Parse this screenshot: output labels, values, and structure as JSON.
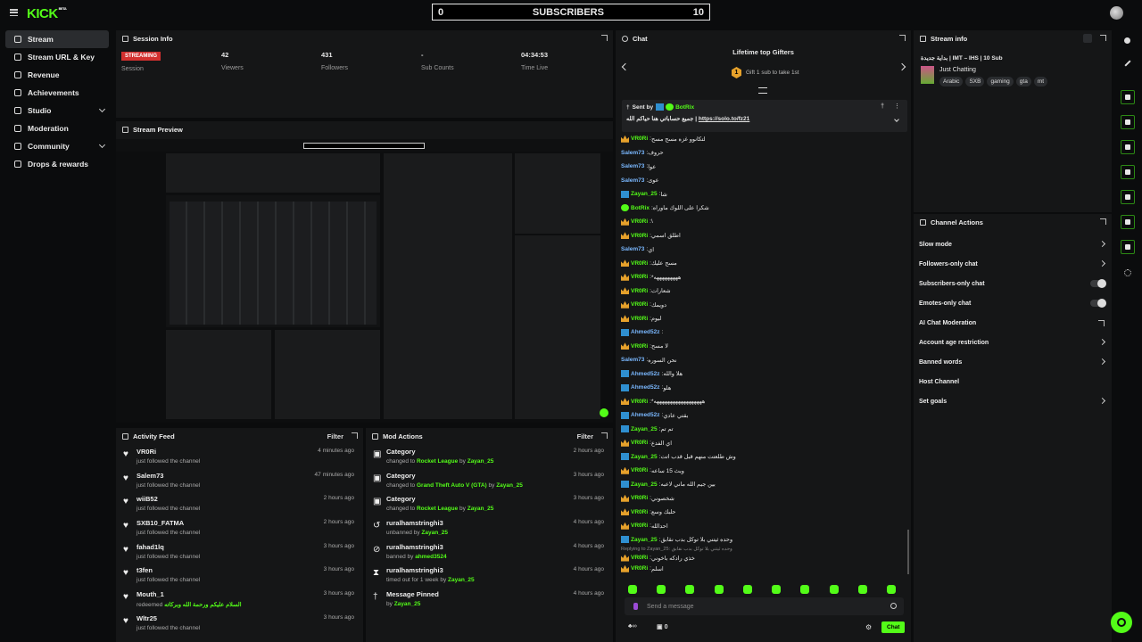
{
  "topbar": {
    "logo": "KICK",
    "logo_badge": "BETA",
    "sub_left": "0",
    "sub_title": "SUBSCRIBERS",
    "sub_right": "10"
  },
  "sidebar": {
    "items": [
      {
        "label": "Stream",
        "active": true,
        "chev": false
      },
      {
        "label": "Stream URL & Key",
        "chev": false
      },
      {
        "label": "Revenue",
        "chev": false
      },
      {
        "label": "Achievements",
        "chev": false
      },
      {
        "label": "Studio",
        "chev": true
      },
      {
        "label": "Moderation",
        "chev": false
      },
      {
        "label": "Community",
        "chev": true
      },
      {
        "label": "Drops & rewards",
        "chev": false
      }
    ]
  },
  "session": {
    "title": "Session Info",
    "status": "STREAMING",
    "session_label": "Session",
    "viewers": "42",
    "viewers_label": "Viewers",
    "followers": "431",
    "followers_label": "Followers",
    "subs": "-",
    "subs_label": "Sub Counts",
    "time": "04:34:53",
    "time_label": "Time Live"
  },
  "preview": {
    "title": "Stream Preview"
  },
  "activity": {
    "title": "Activity Feed",
    "filter": "Filter",
    "rows": [
      {
        "name": "VR0Ri",
        "sub": "just followed the channel",
        "time": "4 minutes ago"
      },
      {
        "name": "Salem73",
        "sub": "just followed the channel",
        "time": "47 minutes ago"
      },
      {
        "name": "wiiB52",
        "sub": "just followed the channel",
        "time": "2 hours ago"
      },
      {
        "name": "SXB10_FATMA",
        "sub": "just followed the channel",
        "time": "2 hours ago"
      },
      {
        "name": "fahad1lq",
        "sub": "just followed the channel",
        "time": "3 hours ago"
      },
      {
        "name": "t3fen",
        "sub": "just followed the channel",
        "time": "3 hours ago"
      },
      {
        "name": "Mouth_1",
        "sub": "redeemed",
        "extra": "السلام عليكم ورحمة الله وبركاته",
        "time": "3 hours ago"
      },
      {
        "name": "Wltr25",
        "sub": "just followed the channel",
        "time": "3 hours ago"
      }
    ]
  },
  "mod": {
    "title": "Mod Actions",
    "filter": "Filter",
    "rows": [
      {
        "name": "Category",
        "pre": "changed to",
        "target": "Rocket League",
        "by": "Zayan_25",
        "time": "2 hours ago"
      },
      {
        "name": "Category",
        "pre": "changed to",
        "target": "Grand Theft Auto V (GTA)",
        "by": "Zayan_25",
        "time": "3 hours ago"
      },
      {
        "name": "Category",
        "pre": "changed to",
        "target": "Rocket League",
        "by": "Zayan_25",
        "time": "3 hours ago"
      },
      {
        "name": "ruralhamstringhi3",
        "pre": "unbanned by",
        "target": "Zayan_25",
        "by": "",
        "time": "4 hours ago"
      },
      {
        "name": "ruralhamstringhi3",
        "pre": "banned by",
        "target": "ahmed3524",
        "by": "",
        "time": "4 hours ago"
      },
      {
        "name": "ruralhamstringhi3",
        "pre": "timed out for 1 week by",
        "target": "Zayan_25",
        "by": "",
        "time": "4 hours ago"
      },
      {
        "name": "Message Pinned",
        "pre": "by",
        "target": "Zayan_25",
        "by": "",
        "time": "4 hours ago"
      }
    ]
  },
  "chat": {
    "title": "Chat",
    "gifters_title": "Lifetime top Gifters",
    "gift_rank": "1",
    "gift_text": "Gift 1 sub to take 1st",
    "pinned_by_label": "Sent by",
    "pinned_user": "BotRix",
    "pinned_text": "جميع حساباتي هنا حياكم الله |",
    "pinned_link": "https://solo.to/fz21",
    "messages": [
      {
        "u": "VR0Ri",
        "c": "#53fc18",
        "b": "crown",
        "t": "لتكانوو غزه مسح مسح"
      },
      {
        "u": "Salem73",
        "c": "#7ab8ff",
        "b": "",
        "t": "حروف"
      },
      {
        "u": "Salem73",
        "c": "#7ab8ff",
        "b": "",
        "t": "عوا"
      },
      {
        "u": "Salem73",
        "c": "#7ab8ff",
        "b": "",
        "t": "عوى"
      },
      {
        "u": "Zayan_25",
        "c": "#53fc18",
        "b": "bolt",
        "t": "شا"
      },
      {
        "u": "BotRix",
        "c": "#53fc18",
        "b": "green",
        "t": "شكرا على اللوك ماوراه"
      },
      {
        "u": "VR0Ri",
        "c": "#53fc18",
        "b": "crown",
        "t": "\\"
      },
      {
        "u": "VR0Ri",
        "c": "#53fc18",
        "b": "crown",
        "t": "اطلق اسمي"
      },
      {
        "u": "Salem73",
        "c": "#7ab8ff",
        "b": "",
        "t": "اي"
      },
      {
        "u": "VR0Ri",
        "c": "#53fc18",
        "b": "crown",
        "t": "مسح عليك"
      },
      {
        "u": "VR0Ri",
        "c": "#53fc18",
        "b": "crown",
        "t": "*هههههههههه"
      },
      {
        "u": "VR0Ri",
        "c": "#53fc18",
        "b": "crown",
        "t": "شعارات"
      },
      {
        "u": "VR0Ri",
        "c": "#53fc18",
        "b": "crown",
        "t": "دويمك"
      },
      {
        "u": "VR0Ri",
        "c": "#53fc18",
        "b": "crown",
        "t": "ليوم"
      },
      {
        "u": "Ahmed52z",
        "c": "#7ab8ff",
        "b": "bolt",
        "t": ""
      },
      {
        "u": "VR0Ri",
        "c": "#53fc18",
        "b": "crown",
        "t": "لا مسح"
      },
      {
        "u": "Salem73",
        "c": "#7ab8ff",
        "b": "",
        "t": "نحن السوره"
      },
      {
        "u": "Ahmed52z",
        "c": "#7ab8ff",
        "b": "bolt",
        "t": "هلا والله"
      },
      {
        "u": "Ahmed52z",
        "c": "#7ab8ff",
        "b": "bolt",
        "t": "هلو"
      },
      {
        "u": "VR0Ri",
        "c": "#53fc18",
        "b": "crown",
        "t": "*ههههههههههههههههههه"
      },
      {
        "u": "Ahmed52z",
        "c": "#7ab8ff",
        "b": "bolt",
        "t": "بقتي عادي"
      },
      {
        "u": "Zayan_25",
        "c": "#53fc18",
        "b": "bolt",
        "t": "تم تم"
      },
      {
        "u": "VR0Ri",
        "c": "#53fc18",
        "b": "crown",
        "t": "اي الفدع"
      },
      {
        "u": "Zayan_25",
        "c": "#53fc18",
        "b": "bolt",
        "t": "وش طلعتت منهم قبل قدب اتت"
      },
      {
        "u": "VR0Ri",
        "c": "#53fc18",
        "b": "crown",
        "t": "وبث 15 ساعه"
      },
      {
        "u": "Zayan_25",
        "c": "#53fc18",
        "b": "bolt",
        "t": "بين جيم الله ماني لاعبه"
      },
      {
        "u": "VR0Ri",
        "c": "#53fc18",
        "b": "crown",
        "t": "شخصوني"
      },
      {
        "u": "VR0Ri",
        "c": "#53fc18",
        "b": "crown",
        "t": "حلبك وسع"
      },
      {
        "u": "VR0Ri",
        "c": "#53fc18",
        "b": "crown",
        "t": "احدالله"
      },
      {
        "u": "Zayan_25",
        "c": "#53fc18",
        "b": "bolt",
        "t": "وحده ثيتني بلا توكل بدب نقابق"
      },
      {
        "u": "VR0Ri",
        "c": "#53fc18",
        "b": "crown",
        "t": "خذي رادكه باخوني",
        "reply": "Replying to Zayan_25: وحده ثيتني بلا توكل بدب نقابق"
      },
      {
        "u": "VR0Ri",
        "c": "#53fc18",
        "b": "crown",
        "t": "اسلم"
      }
    ],
    "send_placeholder": "Send a message",
    "footer_count": "0",
    "chat_btn": "Chat"
  },
  "stream_info": {
    "title": "Stream info",
    "stream_title": "بداية جديدة | IMT – IHS | 10 Sub",
    "category": "Just Chatting",
    "tags": [
      "Arabic",
      "SXB",
      "gaming",
      "gta",
      "mt"
    ]
  },
  "channel_actions": {
    "title": "Channel Actions",
    "items": [
      {
        "label": "Slow mode",
        "kind": "chev"
      },
      {
        "label": "Followers-only chat",
        "kind": "chev"
      },
      {
        "label": "Subscribers-only chat",
        "kind": "toggle"
      },
      {
        "label": "Emotes-only chat",
        "kind": "toggle"
      },
      {
        "label": "AI Chat Moderation",
        "kind": "ext"
      },
      {
        "label": "Account age restriction",
        "kind": "chev"
      },
      {
        "label": "Banned words",
        "kind": "chev"
      },
      {
        "label": "Host Channel",
        "kind": "none"
      },
      {
        "label": "Set goals",
        "kind": "chev"
      }
    ]
  },
  "colors": {
    "accent": "#53fc18",
    "streaming": "#d3302f",
    "panel": "#151617",
    "bg": "#0b0c0d"
  }
}
